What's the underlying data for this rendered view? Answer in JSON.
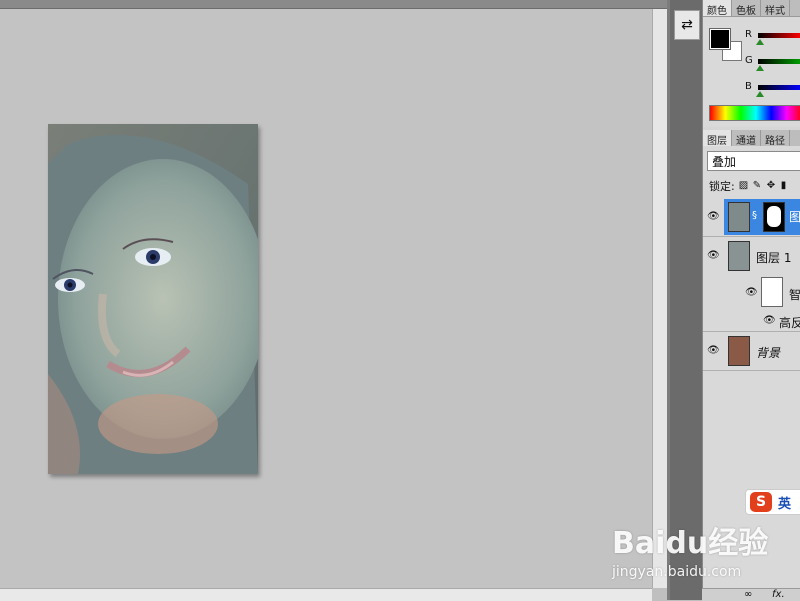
{
  "panels": {
    "color_tabs": [
      "颜色",
      "色板",
      "样式"
    ],
    "color_channels": [
      "R",
      "G",
      "B"
    ],
    "layer_tabs": [
      "图层",
      "通道",
      "路径"
    ],
    "blend_mode": "叠加",
    "lock_label": "锁定:",
    "layers": [
      {
        "name": "图",
        "selected": true
      },
      {
        "name": "图层 1",
        "selected": false
      },
      {
        "name": "智",
        "selected": false
      },
      {
        "name": "高反",
        "selected": false
      },
      {
        "name": "背景",
        "selected": false
      }
    ]
  },
  "ime": {
    "logo": "S",
    "mode": "英"
  },
  "watermark": {
    "main": "Baidu经验",
    "sub": "jingyan.baidu.com"
  },
  "fx_label": "fx.",
  "colors": {
    "selection": "#3a86e0",
    "canvas": "#c3c3c3"
  },
  "icons": [
    "history-icon",
    "eye-icon",
    "lock-transparent-icon",
    "brush-icon",
    "move-icon",
    "lock-icon",
    "link-icon",
    "fx-icon"
  ]
}
